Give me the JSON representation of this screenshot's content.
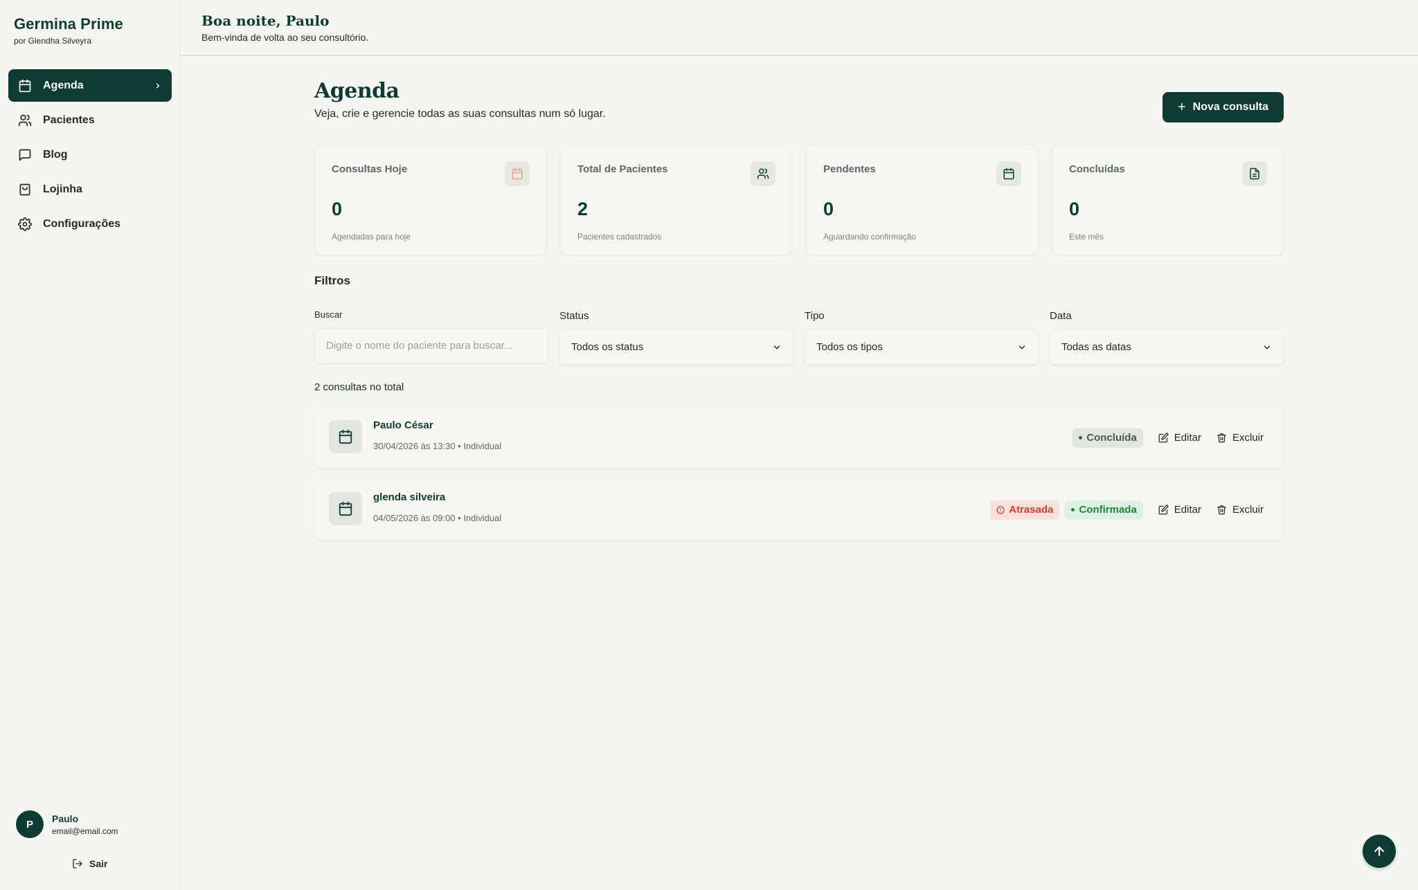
{
  "sidebar": {
    "brand": "Germina Prime",
    "brand_sub": "por Glendha Silveyra",
    "items": [
      {
        "label": "Agenda"
      },
      {
        "label": "Pacientes"
      },
      {
        "label": "Blog"
      },
      {
        "label": "Lojinha"
      },
      {
        "label": "Configurações"
      }
    ],
    "user": {
      "initial": "P",
      "name": "Paulo",
      "email": "email@email.com"
    },
    "logout": "Sair"
  },
  "header": {
    "greeting": "Boa noite, Paulo",
    "subtitle": "Bem-vinda de volta ao seu consultório."
  },
  "page": {
    "title": "Agenda",
    "subtitle": "Veja, crie e gerencie todas as suas consultas num só lugar.",
    "new_button": "Nova consulta"
  },
  "stats": [
    {
      "label": "Consultas Hoje",
      "value": "0",
      "desc": "Agendadas para hoje",
      "icon": "calendar-icon"
    },
    {
      "label": "Total de Pacientes",
      "value": "2",
      "desc": "Pacientes cadastrados",
      "icon": "users-icon"
    },
    {
      "label": "Pendentes",
      "value": "0",
      "desc": "Aguardando confirmação",
      "icon": "calendar-icon"
    },
    {
      "label": "Concluídas",
      "value": "0",
      "desc": "Este mês",
      "icon": "document-icon"
    }
  ],
  "filters": {
    "title": "Filtros",
    "search": {
      "label": "Buscar",
      "placeholder": "Digite o nome do paciente para buscar..."
    },
    "status": {
      "label": "Status",
      "value": "Todos os status"
    },
    "type": {
      "label": "Tipo",
      "value": "Todos os tipos"
    },
    "date": {
      "label": "Data",
      "value": "Todas as datas"
    }
  },
  "total_text": "2 consultas no total",
  "appointments": [
    {
      "name": "Paulo César",
      "meta": "30/04/2026 às 13:30 • Individual",
      "status": "Concluída",
      "edit": "Editar",
      "delete": "Excluir"
    },
    {
      "name": "glenda silveira",
      "meta": "04/05/2026 às 09:00 • Individual",
      "late": "Atrasada",
      "status": "Confirmada",
      "edit": "Editar",
      "delete": "Excluir"
    }
  ],
  "colors": {
    "primary": "#0f3b32",
    "background": "#f5f5f1",
    "late": "#d43c36",
    "confirmed": "#22863a"
  }
}
